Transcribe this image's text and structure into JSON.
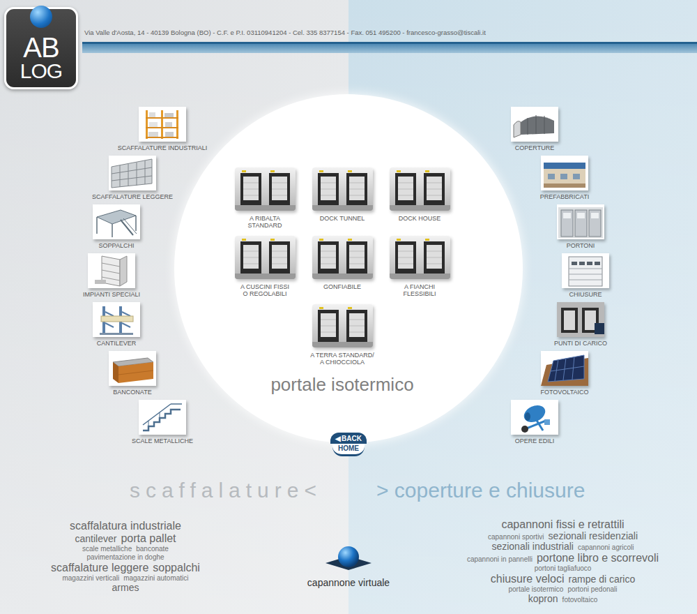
{
  "logo": {
    "top": "AB",
    "bottom": "LOG"
  },
  "header": {
    "contact": "Via Valle d'Aosta, 14 - 40139 Bologna (BO) - C.F. e P.I. 03110941204 - Cel. 335 8377154 - Fax. 051 495200 - francesco-grasso@tiscali.it"
  },
  "left_menu": {
    "items": [
      {
        "label": "SCAFFALATURE INDUSTRIALI"
      },
      {
        "label": "SCAFFALATURE LEGGERE"
      },
      {
        "label": "SOPPALCHI"
      },
      {
        "label": "IMPIANTI SPECIALI"
      },
      {
        "label": "CANTILEVER"
      },
      {
        "label": "BANCONATE"
      },
      {
        "label": "SCALE METALLICHE"
      }
    ]
  },
  "right_menu": {
    "items": [
      {
        "label": "COPERTURE"
      },
      {
        "label": "PREFABBRICATI"
      },
      {
        "label": "PORTONI"
      },
      {
        "label": "CHIUSURE"
      },
      {
        "label": "PUNTI DI CARICO"
      },
      {
        "label": "FOTOVOLTAICO"
      },
      {
        "label": "OPERE EDILI"
      }
    ]
  },
  "center": {
    "products": [
      {
        "lines": [
          "A RIBALTA",
          "STANDARD"
        ]
      },
      {
        "lines": [
          "DOCK TUNNEL"
        ]
      },
      {
        "lines": [
          "DOCK HOUSE"
        ]
      },
      {
        "lines": [
          "A CUSCINI FISSI",
          "O REGOLABILI"
        ]
      },
      {
        "lines": [
          "GONFIABILE"
        ]
      },
      {
        "lines": [
          "A FIANCHI",
          "FLESSIBILI"
        ]
      },
      {
        "lines": [
          "A TERRA STANDARD/",
          "A CHIOCCIOLA"
        ]
      }
    ],
    "title": "portale isotermico",
    "back": {
      "arrow": "◀",
      "label": "BACK"
    },
    "home": "HOME"
  },
  "sections": {
    "left": "scaffalature<",
    "right": "> coperture e chiusure"
  },
  "left_cloud": [
    [
      {
        "text": "scaffalatura industriale",
        "kind": "big"
      }
    ],
    [
      {
        "text": "cantilever",
        "kind": "mid"
      },
      {
        "text": "porta pallet",
        "kind": "big"
      }
    ],
    [
      {
        "text": "scale metalliche",
        "kind": "small"
      },
      {
        "text": "banconate",
        "kind": "small"
      }
    ],
    [
      {
        "text": "pavimentazione in doghe",
        "kind": "small"
      }
    ],
    [
      {
        "text": "scaffalature leggere",
        "kind": "big"
      },
      {
        "text": "soppalchi",
        "kind": "big"
      }
    ],
    [
      {
        "text": "magazzini verticali",
        "kind": "small"
      },
      {
        "text": "magazzini automatici",
        "kind": "small"
      }
    ],
    [
      {
        "text": "armes",
        "kind": "mid"
      }
    ]
  ],
  "right_cloud": [
    [
      {
        "text": "capannoni fissi e retrattili",
        "kind": "big"
      }
    ],
    [
      {
        "text": "capannoni sportivi",
        "kind": "small"
      },
      {
        "text": "sezionali residenziali",
        "kind": "mid"
      }
    ],
    [
      {
        "text": "sezionali industriali",
        "kind": "mid"
      },
      {
        "text": "capannoni agricoli",
        "kind": "small"
      }
    ],
    [
      {
        "text": "capannoni in pannelli",
        "kind": "small"
      },
      {
        "text": "portone libro e scorrevoli",
        "kind": "big"
      }
    ],
    [
      {
        "text": "portoni tagliafuoco",
        "kind": "small"
      }
    ],
    [
      {
        "text": "chiusure veloci",
        "kind": "big"
      },
      {
        "text": "rampe di carico",
        "kind": "mid"
      }
    ],
    [
      {
        "text": "portale isotermico",
        "kind": "small"
      },
      {
        "text": "portoni pedonali",
        "kind": "small"
      }
    ],
    [
      {
        "text": "kopron",
        "kind": "mid"
      },
      {
        "text": "fotovoltaico",
        "kind": "small"
      }
    ]
  ],
  "virtual": {
    "label": "capannone virtuale"
  }
}
